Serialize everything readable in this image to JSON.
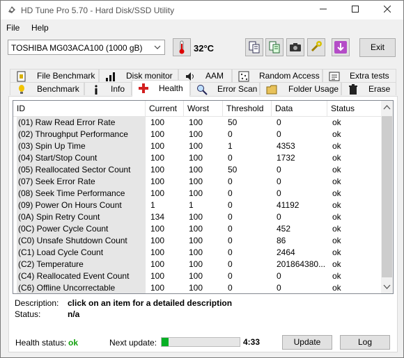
{
  "window": {
    "title": "HD Tune Pro 5.70 - Hard Disk/SSD Utility"
  },
  "menu": {
    "file": "File",
    "help": "Help"
  },
  "toolbar": {
    "drive": "TOSHIBA MG03ACA100 (1000 gB)",
    "temperature": "32°C",
    "exit_label": "Exit"
  },
  "tabs_top": [
    {
      "label": "File Benchmark",
      "icon": "file-benchmark-icon"
    },
    {
      "label": "Disk monitor",
      "icon": "disk-monitor-icon"
    },
    {
      "label": "AAM",
      "icon": "speaker-icon"
    },
    {
      "label": "Random Access",
      "icon": "random-access-icon"
    },
    {
      "label": "Extra tests",
      "icon": "extra-tests-icon"
    }
  ],
  "tabs_bottom": [
    {
      "label": "Benchmark",
      "icon": "benchmark-icon"
    },
    {
      "label": "Info",
      "icon": "info-icon"
    },
    {
      "label": "Health",
      "icon": "health-cross-icon"
    },
    {
      "label": "Error Scan",
      "icon": "magnifier-icon"
    },
    {
      "label": "Folder Usage",
      "icon": "folder-icon"
    },
    {
      "label": "Erase",
      "icon": "trash-icon"
    }
  ],
  "table": {
    "columns": [
      "ID",
      "Current",
      "Worst",
      "Threshold",
      "Data",
      "Status"
    ],
    "rows": [
      [
        "(01) Raw Read Error Rate",
        "100",
        "100",
        "50",
        "0",
        "ok"
      ],
      [
        "(02) Throughput Performance",
        "100",
        "100",
        "0",
        "0",
        "ok"
      ],
      [
        "(03) Spin Up Time",
        "100",
        "100",
        "1",
        "4353",
        "ok"
      ],
      [
        "(04) Start/Stop Count",
        "100",
        "100",
        "0",
        "1732",
        "ok"
      ],
      [
        "(05) Reallocated Sector Count",
        "100",
        "100",
        "50",
        "0",
        "ok"
      ],
      [
        "(07) Seek Error Rate",
        "100",
        "100",
        "0",
        "0",
        "ok"
      ],
      [
        "(08) Seek Time Performance",
        "100",
        "100",
        "0",
        "0",
        "ok"
      ],
      [
        "(09) Power On Hours Count",
        "1",
        "1",
        "0",
        "41192",
        "ok"
      ],
      [
        "(0A) Spin Retry Count",
        "134",
        "100",
        "0",
        "0",
        "ok"
      ],
      [
        "(0C) Power Cycle Count",
        "100",
        "100",
        "0",
        "452",
        "ok"
      ],
      [
        "(C0) Unsafe Shutdown Count",
        "100",
        "100",
        "0",
        "86",
        "ok"
      ],
      [
        "(C1) Load Cycle Count",
        "100",
        "100",
        "0",
        "2464",
        "ok"
      ],
      [
        "(C2) Temperature",
        "100",
        "100",
        "0",
        "201864380...",
        "ok"
      ],
      [
        "(C4) Reallocated Event Count",
        "100",
        "100",
        "0",
        "0",
        "ok"
      ],
      [
        "(C6) Offline Uncorrectable",
        "100",
        "100",
        "0",
        "0",
        "ok"
      ]
    ]
  },
  "description": {
    "label": "Description:",
    "value": "click on an item for a detailed description",
    "status_label": "Status:",
    "status_value": "n/a"
  },
  "footer": {
    "health_label": "Health status:",
    "health_value": "ok",
    "next_update_label": "Next update:",
    "progress": 0.09,
    "countdown": "4:33",
    "update_label": "Update",
    "log_label": "Log"
  },
  "colors": {
    "accent_green": "#06b025",
    "health_ok": "#13a10e"
  }
}
